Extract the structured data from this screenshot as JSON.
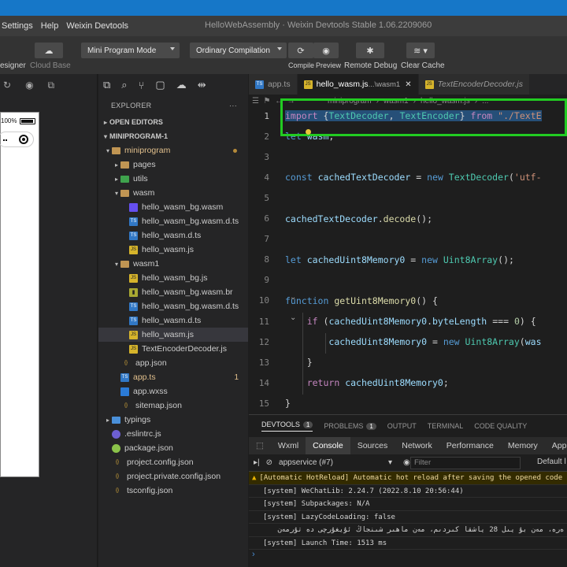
{
  "menu": [
    "Settings",
    "Help",
    "Weixin Devtools"
  ],
  "window_title": "HelloWebAssembly · Weixin Devtools Stable 1.06.2209060",
  "toolbar": {
    "designer_label": "esigner",
    "cloud_base_label": "Cloud Base",
    "mode_select": "Mini Program Mode",
    "compile_select": "Ordinary Compilation",
    "compile_label": "Compile",
    "preview_label": "Preview",
    "remote_debug_label": "Remote Debug",
    "clear_cache_label": "Clear Cache"
  },
  "phone": {
    "battery_text": "100%"
  },
  "explorer": {
    "title": "EXPLORER",
    "more": "···",
    "open_editors": "OPEN EDITORS",
    "project": "MINIPROGRAM-1",
    "items": [
      {
        "label": "miniprogram",
        "icon": "folder-open",
        "indent": 1,
        "twisty": "▾",
        "highlight": true
      },
      {
        "label": "pages",
        "icon": "folder",
        "indent": 2,
        "twisty": "▸"
      },
      {
        "label": "utils",
        "icon": "folder-green",
        "indent": 2,
        "twisty": "▸"
      },
      {
        "label": "wasm",
        "icon": "folder-open",
        "indent": 2,
        "twisty": "▾"
      },
      {
        "label": "hello_wasm_bg.wasm",
        "icon": "wasm",
        "indent": 3
      },
      {
        "label": "hello_wasm_bg.wasm.d.ts",
        "icon": "ts",
        "indent": 3
      },
      {
        "label": "hello_wasm.d.ts",
        "icon": "ts",
        "indent": 3
      },
      {
        "label": "hello_wasm.js",
        "icon": "js",
        "indent": 3
      },
      {
        "label": "wasm1",
        "icon": "folder-open",
        "indent": 2,
        "twisty": "▾"
      },
      {
        "label": "hello_wasm_bg.js",
        "icon": "js",
        "indent": 3
      },
      {
        "label": "hello_wasm_bg.wasm.br",
        "icon": "br",
        "indent": 3
      },
      {
        "label": "hello_wasm_bg.wasm.d.ts",
        "icon": "ts",
        "indent": 3
      },
      {
        "label": "hello_wasm.d.ts",
        "icon": "ts",
        "indent": 3
      },
      {
        "label": "hello_wasm.js",
        "icon": "js",
        "indent": 3,
        "selected": true
      },
      {
        "label": "TextEncoderDecoder.js",
        "icon": "js",
        "indent": 3
      },
      {
        "label": "app.json",
        "icon": "json",
        "indent": 2
      },
      {
        "label": "app.ts",
        "icon": "ts",
        "indent": 2,
        "badge": "1",
        "warn": true
      },
      {
        "label": "app.wxss",
        "icon": "wxss",
        "indent": 2
      },
      {
        "label": "sitemap.json",
        "icon": "json",
        "indent": 2
      },
      {
        "label": "typings",
        "icon": "folder-blue",
        "indent": 1,
        "twisty": "▸"
      },
      {
        "label": ".eslintrc.js",
        "icon": "eslint",
        "indent": 1
      },
      {
        "label": "package.json",
        "icon": "pkg",
        "indent": 1
      },
      {
        "label": "project.config.json",
        "icon": "json",
        "indent": 1
      },
      {
        "label": "project.private.config.json",
        "icon": "json",
        "indent": 1
      },
      {
        "label": "tsconfig.json",
        "icon": "json",
        "indent": 1
      }
    ]
  },
  "editor": {
    "tabs": [
      {
        "label": "app.ts",
        "icon": "ts"
      },
      {
        "label": "hello_wasm.js",
        "suffix": " ...\\wasm1",
        "icon": "js",
        "active": true,
        "close": "✕"
      },
      {
        "label": "TextEncoderDecoder.js",
        "icon": "js",
        "italic": true
      }
    ],
    "breadcrumb": [
      "miniprogram",
      "wasm1",
      "hello_wasm.js",
      "..."
    ],
    "lines": [
      {
        "n": "1",
        "text": "import {TextDecoder, TextEncoder} from \"./TextE"
      },
      {
        "n": "2",
        "text": "let wasm;"
      },
      {
        "n": "3",
        "text": ""
      },
      {
        "n": "4",
        "text": "const cachedTextDecoder = new TextDecoder('utf-"
      },
      {
        "n": "5",
        "text": ""
      },
      {
        "n": "6",
        "text": "cachedTextDecoder.decode();"
      },
      {
        "n": "7",
        "text": ""
      },
      {
        "n": "8",
        "text": "let cachedUint8Memory0 = new Uint8Array();"
      },
      {
        "n": "9",
        "text": ""
      },
      {
        "n": "10",
        "text": "function getUint8Memory0() {"
      },
      {
        "n": "11",
        "text": "    if (cachedUint8Memory0.byteLength === 0) {"
      },
      {
        "n": "12",
        "text": "        cachedUint8Memory0 = new Uint8Array(was"
      },
      {
        "n": "13",
        "text": "    }"
      },
      {
        "n": "14",
        "text": "    return cachedUint8Memory0;"
      },
      {
        "n": "15",
        "text": "}"
      }
    ]
  },
  "panel": {
    "tabs": [
      {
        "label": "DEVTOOLS",
        "badge": "1",
        "active": true
      },
      {
        "label": "PROBLEMS",
        "badge": "1"
      },
      {
        "label": "OUTPUT"
      },
      {
        "label": "TERMINAL"
      },
      {
        "label": "CODE QUALITY"
      }
    ]
  },
  "devtools": {
    "tabs": [
      "Wxml",
      "Console",
      "Sources",
      "Network",
      "Performance",
      "Memory",
      "AppD"
    ],
    "active_tab": "Console",
    "context": "appservice (#7)",
    "filter_placeholder": "Filter",
    "levels": "Default l",
    "logs": [
      {
        "type": "warn",
        "text": "[Automatic HotReload] Automatic hot reload after saving the opened code"
      },
      {
        "type": "info",
        "text": "[system] WeChatLib: 2.24.7 (2022.8.10 20:56:44)"
      },
      {
        "type": "info",
        "text": "[system] Subpackages: N/A"
      },
      {
        "type": "info",
        "text": "[system] LazyCodeLoading: false"
      },
      {
        "type": "info",
        "text": "ەرە، مەن بۇ يىل 28 ياشقا كىردىم، مەن ماھىر شىنجاڭ ئۇيغۇرچى دە تۇرمەن"
      },
      {
        "type": "info",
        "text": "[system] Launch Time: 1513 ms"
      }
    ],
    "prompt": "›"
  },
  "colors": {
    "highlight_box": "#22cc22",
    "selection": "#264f78",
    "desktop_blue": "#1677c8"
  }
}
